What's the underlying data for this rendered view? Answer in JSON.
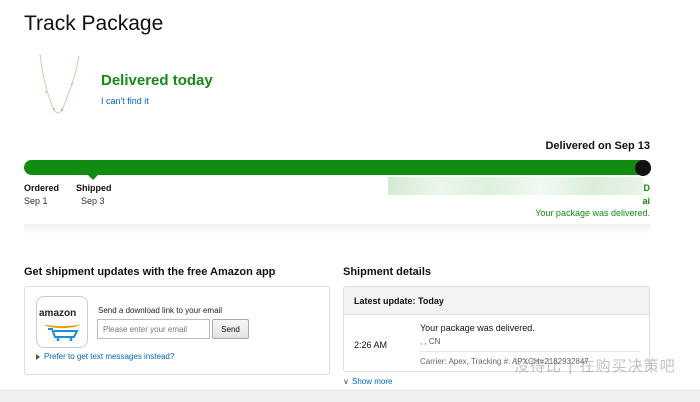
{
  "page": {
    "title": "Track Package"
  },
  "status": {
    "heading": "Delivered today",
    "cant_find": "I can't find it",
    "delivered_on": "Delivered on Sep 13",
    "right_dest_1": "D",
    "right_dest_2": "ai",
    "message": "Your package was delivered."
  },
  "timeline": {
    "steps": [
      {
        "label": "Ordered",
        "date": "Sep 1"
      },
      {
        "label": "Shipped",
        "date": "Sep 3"
      }
    ],
    "progress": 1.0
  },
  "app_updates": {
    "title": "Get shipment updates with the free Amazon app",
    "send_label": "Send a download link to your email",
    "email_placeholder": "Please enter your email",
    "send_button": "Send",
    "text_link": "Prefer to get text messages instead?",
    "logo_text": "amazon"
  },
  "shipment_details": {
    "title": "Shipment details",
    "latest_update": "Latest update: Today",
    "time": "2:26 AM",
    "message": "Your package was delivered.",
    "location": ", , CN",
    "carrier": "Carrier: Apex, Tracking #: APXCH=2182932847",
    "show_more": "Show more"
  },
  "watermark": "没得比 | 在购买决策吧",
  "colors": {
    "green": "#118c11",
    "link": "#0066c0",
    "end_dot": "#111111"
  }
}
